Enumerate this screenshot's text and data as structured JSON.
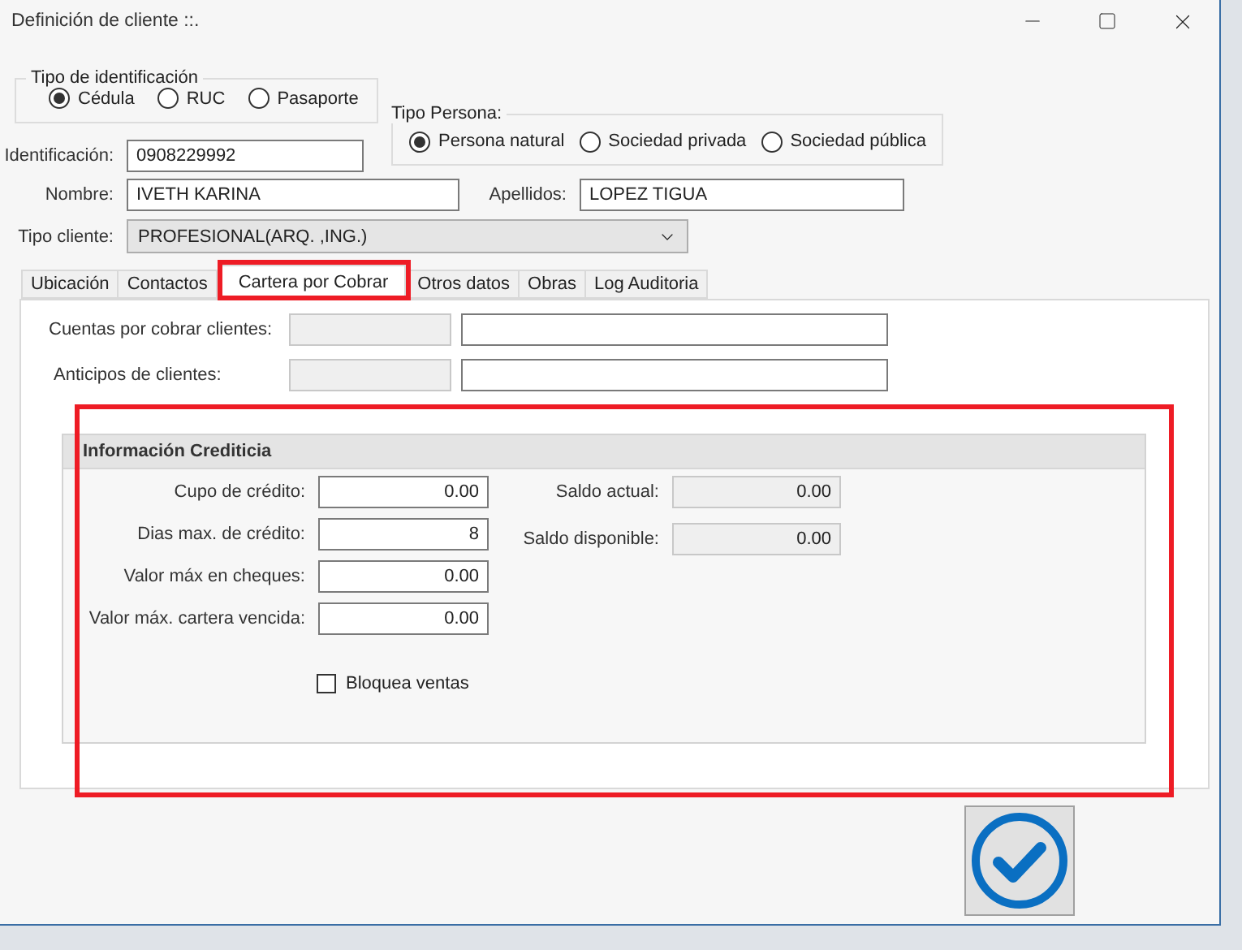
{
  "window": {
    "title": "Definición de cliente ::."
  },
  "id_type": {
    "legend": "Tipo de identificación",
    "options": [
      {
        "label": "Cédula",
        "selected": true
      },
      {
        "label": "RUC",
        "selected": false
      },
      {
        "label": "Pasaporte",
        "selected": false
      }
    ]
  },
  "person_type": {
    "legend": "Tipo Persona:",
    "options": [
      {
        "label": "Persona natural",
        "selected": true
      },
      {
        "label": "Sociedad privada",
        "selected": false
      },
      {
        "label": "Sociedad pública",
        "selected": false
      }
    ]
  },
  "identificacion": {
    "label": "Identificación:",
    "value": "0908229992"
  },
  "nombre": {
    "label": "Nombre:",
    "value": "IVETH KARINA"
  },
  "apellidos": {
    "label": "Apellidos:",
    "value": "LOPEZ TIGUA"
  },
  "tipo_cliente": {
    "label": "Tipo cliente:",
    "value": "PROFESIONAL(ARQ. ,ING.)"
  },
  "tabs": [
    {
      "label": "Ubicación",
      "selected": false
    },
    {
      "label": "Contactos",
      "selected": false
    },
    {
      "label": "Cartera por Cobrar",
      "selected": true
    },
    {
      "label": "Otros datos",
      "selected": false
    },
    {
      "label": "Obras",
      "selected": false
    },
    {
      "label": "Log Auditoria",
      "selected": false
    }
  ],
  "accounts": [
    {
      "label": "Cuentas por cobrar clientes:"
    },
    {
      "label": "Anticipos de clientes:"
    }
  ],
  "credit_info": {
    "title": "Información Crediticia",
    "fields": [
      {
        "label": "Cupo de crédito:",
        "value": "0.00"
      },
      {
        "label": "Dias max. de crédito:",
        "value": "8"
      },
      {
        "label": "Valor máx en cheques:",
        "value": "0.00"
      },
      {
        "label": "Valor máx. cartera vencida:",
        "value": "0.00"
      }
    ],
    "balances": [
      {
        "label": "Saldo actual:",
        "value": "0.00"
      },
      {
        "label": "Saldo disponible:",
        "value": "0.00"
      }
    ],
    "block_sales": {
      "label": "Bloquea ventas",
      "checked": false
    }
  }
}
